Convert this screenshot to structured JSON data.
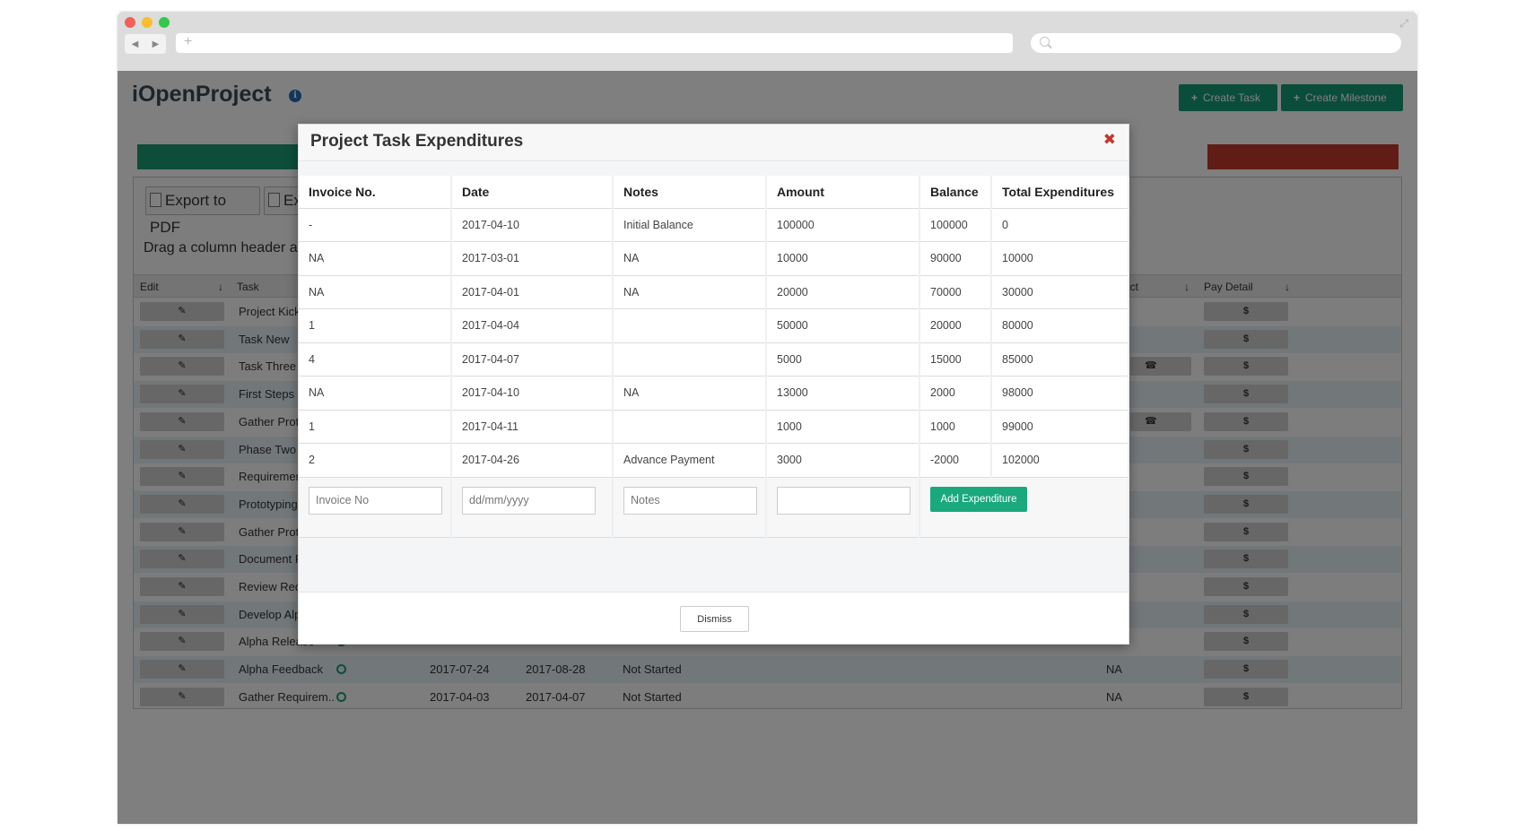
{
  "browser": {
    "url_placeholder": "+",
    "nav_back": "◀",
    "nav_forward": "▶"
  },
  "app": {
    "title": "iOpenProject",
    "create_task_label": "Create Task",
    "create_milestone_label": "Create Milestone",
    "export_pdf_label": "Export to PDF",
    "export_excel_label": "Ex",
    "drag_hint": "Drag a column header an",
    "columns": {
      "edit": "Edit",
      "task": "Task",
      "contact": "act",
      "pay_detail": "Pay Detail"
    },
    "edit_glyph": "✎",
    "pay_glyph": "$",
    "phone_glyph": "☎",
    "tasks": [
      {
        "name": "Project Kick",
        "start": "",
        "end": "",
        "status": "",
        "contact": "",
        "phone": false
      },
      {
        "name": "Task New",
        "start": "",
        "end": "",
        "status": "",
        "contact": "",
        "phone": false
      },
      {
        "name": "Task Three",
        "start": "",
        "end": "",
        "status": "",
        "contact": "",
        "phone": true
      },
      {
        "name": "First Steps",
        "start": "",
        "end": "",
        "status": "",
        "contact": "",
        "phone": false
      },
      {
        "name": "Gather Proto",
        "start": "",
        "end": "",
        "status": "",
        "contact": "",
        "phone": true
      },
      {
        "name": "Phase Two K",
        "start": "",
        "end": "",
        "status": "",
        "contact": "",
        "phone": false
      },
      {
        "name": "Requirement",
        "start": "",
        "end": "",
        "status": "",
        "contact": "",
        "phone": false
      },
      {
        "name": "Prototyping",
        "start": "",
        "end": "",
        "status": "",
        "contact": "",
        "phone": false
      },
      {
        "name": "Gather Proto",
        "start": "",
        "end": "",
        "status": "",
        "contact": "",
        "phone": false
      },
      {
        "name": "Document P",
        "start": "",
        "end": "",
        "status": "",
        "contact": "",
        "phone": false
      },
      {
        "name": "Review Requ",
        "start": "",
        "end": "",
        "status": "",
        "contact": "",
        "phone": false
      },
      {
        "name": "Develop Alp",
        "start": "",
        "end": "",
        "status": "",
        "contact": "",
        "phone": false
      },
      {
        "name": "Alpha Release",
        "start": "",
        "end": "",
        "status": "",
        "contact": "",
        "phone": false
      },
      {
        "name": "Alpha Feedback",
        "start": "2017-07-24",
        "end": "2017-08-28",
        "status": "Not Started",
        "contact": "NA",
        "phone": false
      },
      {
        "name": "Gather Requirem..",
        "start": "2017-04-03",
        "end": "2017-04-07",
        "status": "Not Started",
        "contact": "NA",
        "phone": false
      }
    ]
  },
  "modal": {
    "title": "Project Task Expenditures",
    "close_glyph": "✖",
    "headers": [
      "Invoice No.",
      "Date",
      "Notes",
      "Amount",
      "Balance",
      "Total Expenditures"
    ],
    "rows": [
      [
        "-",
        "2017-04-10",
        "Initial Balance",
        "100000",
        "100000",
        "0"
      ],
      [
        "NA",
        "2017-03-01",
        "NA",
        "10000",
        "90000",
        "10000"
      ],
      [
        "NA",
        "2017-04-01",
        "NA",
        "20000",
        "70000",
        "30000"
      ],
      [
        "1",
        "2017-04-04",
        "",
        "50000",
        "20000",
        "80000"
      ],
      [
        "4",
        "2017-04-07",
        "",
        "5000",
        "15000",
        "85000"
      ],
      [
        "NA",
        "2017-04-10",
        "NA",
        "13000",
        "2000",
        "98000"
      ],
      [
        "1",
        "2017-04-11",
        "",
        "1000",
        "1000",
        "99000"
      ],
      [
        "2",
        "2017-04-26",
        "Advance Payment",
        "3000",
        "-2000",
        "102000"
      ]
    ],
    "form": {
      "invoice_placeholder": "Invoice No",
      "date_placeholder": "dd/mm/yyyy",
      "notes_placeholder": "Notes",
      "amount_placeholder": "",
      "add_label": "Add Expenditure"
    },
    "dismiss_label": "Dismiss"
  },
  "colors": {
    "accent": "#19a97c",
    "danger": "#c0392b",
    "info": "#1f6dbb"
  }
}
